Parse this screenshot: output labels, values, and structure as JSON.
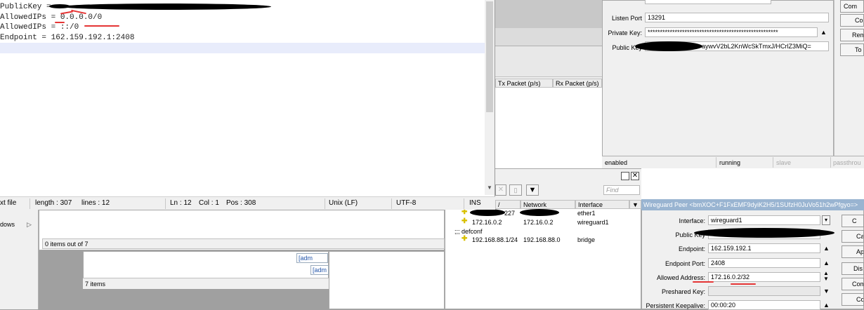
{
  "editor": {
    "lines": [
      "PublicKey = ",
      "AllowedIPs = 0.0.0.0/0",
      "AllowedIPs = ::/0",
      "Endpoint = 162.159.192.1:2408",
      ""
    ],
    "status": {
      "filetype": "xt file",
      "length": "length : 307",
      "lines": "lines : 12",
      "ln": "Ln : 12",
      "col": "Col : 1",
      "pos": "Pos : 308",
      "eol": "Unix (LF)",
      "encoding": "UTF-8",
      "ins": "INS"
    }
  },
  "interface_window": {
    "listen_port_label": "Listen Port",
    "listen_port": "13291",
    "private_key_label": "Private Key:",
    "private_key": "*****************************************************",
    "public_key_label": "Public Key",
    "public_key_suffix": "aywvV2bL2KnWcSkTmxJ/HCrlZ3MiQ=",
    "status_enabled": "enabled",
    "status_running": "running",
    "status_slave": "slave",
    "status_passthrough": "passthrou",
    "buttons": [
      "Com",
      "Co",
      "Rem",
      "To"
    ]
  },
  "traffic_table": {
    "tx_header": "Tx Packet (p/s)",
    "rx_header": "Rx Packet (p/s)"
  },
  "route_list": {
    "find_placeholder": "Find",
    "headers": [
      "Network",
      "Interface"
    ],
    "rows": [
      {
        "address": "227",
        "network": "",
        "interface": "ether1"
      },
      {
        "address": "172.16.0.2",
        "network": "172.16.0.2",
        "interface": "wireguard1"
      }
    ],
    "group": ";;; defconf",
    "group_rows": [
      {
        "address": "192.168.88.1/24",
        "network": "192.168.88.0",
        "interface": "bridge"
      }
    ]
  },
  "left_panels": {
    "dows": "dows",
    "items_count_1": "0 items out of 7",
    "items_count_2": "7 items",
    "adm1": "[adm",
    "adm2": "[adm"
  },
  "peer_window": {
    "title": "Wireguard Peer <bmXOC+F1FxEMF9dyiK2H5/1SUfzH0JuVo51h2wPfgyo=>",
    "interface_label": "Interface:",
    "interface": "wireguard1",
    "public_key_label": "Public Key",
    "endpoint_label": "Endpoint:",
    "endpoint": "162.159.192.1",
    "endpoint_port_label": "Endpoint Port:",
    "endpoint_port": "2408",
    "allowed_address_label": "Allowed Address:",
    "allowed_address": "172.16.0.2/32",
    "preshared_key_label": "Preshared Key:",
    "preshared_key": "",
    "keepalive_label": "Persistent Keepalive:",
    "keepalive": "00:00:20",
    "buttons": [
      "C",
      "Ca",
      "Ap",
      "Dis",
      "Com",
      "Co"
    ]
  }
}
